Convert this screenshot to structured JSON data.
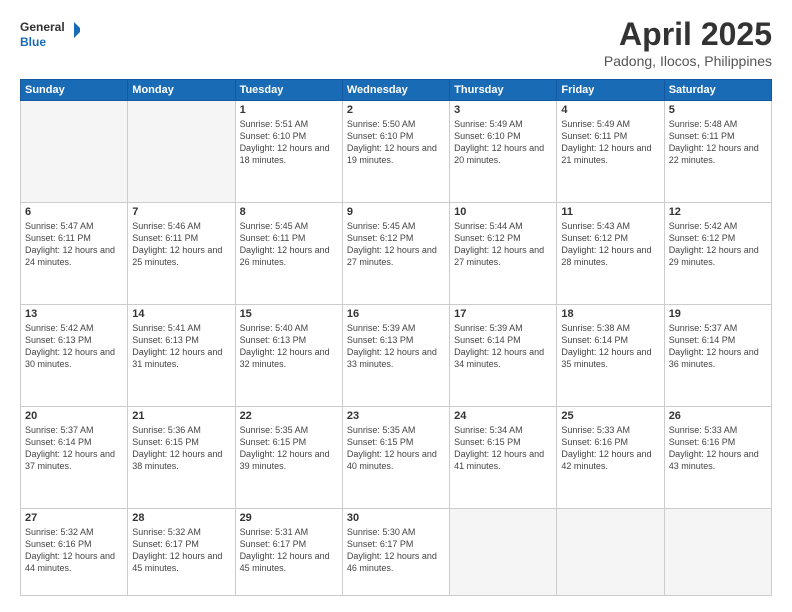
{
  "header": {
    "logo_line1": "General",
    "logo_line2": "Blue",
    "main_title": "April 2025",
    "subtitle": "Padong, Ilocos, Philippines"
  },
  "days_of_week": [
    "Sunday",
    "Monday",
    "Tuesday",
    "Wednesday",
    "Thursday",
    "Friday",
    "Saturday"
  ],
  "weeks": [
    [
      {
        "day": "",
        "info": ""
      },
      {
        "day": "",
        "info": ""
      },
      {
        "day": "1",
        "info": "Sunrise: 5:51 AM\nSunset: 6:10 PM\nDaylight: 12 hours\nand 18 minutes."
      },
      {
        "day": "2",
        "info": "Sunrise: 5:50 AM\nSunset: 6:10 PM\nDaylight: 12 hours\nand 19 minutes."
      },
      {
        "day": "3",
        "info": "Sunrise: 5:49 AM\nSunset: 6:10 PM\nDaylight: 12 hours\nand 20 minutes."
      },
      {
        "day": "4",
        "info": "Sunrise: 5:49 AM\nSunset: 6:11 PM\nDaylight: 12 hours\nand 21 minutes."
      },
      {
        "day": "5",
        "info": "Sunrise: 5:48 AM\nSunset: 6:11 PM\nDaylight: 12 hours\nand 22 minutes."
      }
    ],
    [
      {
        "day": "6",
        "info": "Sunrise: 5:47 AM\nSunset: 6:11 PM\nDaylight: 12 hours\nand 24 minutes."
      },
      {
        "day": "7",
        "info": "Sunrise: 5:46 AM\nSunset: 6:11 PM\nDaylight: 12 hours\nand 25 minutes."
      },
      {
        "day": "8",
        "info": "Sunrise: 5:45 AM\nSunset: 6:11 PM\nDaylight: 12 hours\nand 26 minutes."
      },
      {
        "day": "9",
        "info": "Sunrise: 5:45 AM\nSunset: 6:12 PM\nDaylight: 12 hours\nand 27 minutes."
      },
      {
        "day": "10",
        "info": "Sunrise: 5:44 AM\nSunset: 6:12 PM\nDaylight: 12 hours\nand 27 minutes."
      },
      {
        "day": "11",
        "info": "Sunrise: 5:43 AM\nSunset: 6:12 PM\nDaylight: 12 hours\nand 28 minutes."
      },
      {
        "day": "12",
        "info": "Sunrise: 5:42 AM\nSunset: 6:12 PM\nDaylight: 12 hours\nand 29 minutes."
      }
    ],
    [
      {
        "day": "13",
        "info": "Sunrise: 5:42 AM\nSunset: 6:13 PM\nDaylight: 12 hours\nand 30 minutes."
      },
      {
        "day": "14",
        "info": "Sunrise: 5:41 AM\nSunset: 6:13 PM\nDaylight: 12 hours\nand 31 minutes."
      },
      {
        "day": "15",
        "info": "Sunrise: 5:40 AM\nSunset: 6:13 PM\nDaylight: 12 hours\nand 32 minutes."
      },
      {
        "day": "16",
        "info": "Sunrise: 5:39 AM\nSunset: 6:13 PM\nDaylight: 12 hours\nand 33 minutes."
      },
      {
        "day": "17",
        "info": "Sunrise: 5:39 AM\nSunset: 6:14 PM\nDaylight: 12 hours\nand 34 minutes."
      },
      {
        "day": "18",
        "info": "Sunrise: 5:38 AM\nSunset: 6:14 PM\nDaylight: 12 hours\nand 35 minutes."
      },
      {
        "day": "19",
        "info": "Sunrise: 5:37 AM\nSunset: 6:14 PM\nDaylight: 12 hours\nand 36 minutes."
      }
    ],
    [
      {
        "day": "20",
        "info": "Sunrise: 5:37 AM\nSunset: 6:14 PM\nDaylight: 12 hours\nand 37 minutes."
      },
      {
        "day": "21",
        "info": "Sunrise: 5:36 AM\nSunset: 6:15 PM\nDaylight: 12 hours\nand 38 minutes."
      },
      {
        "day": "22",
        "info": "Sunrise: 5:35 AM\nSunset: 6:15 PM\nDaylight: 12 hours\nand 39 minutes."
      },
      {
        "day": "23",
        "info": "Sunrise: 5:35 AM\nSunset: 6:15 PM\nDaylight: 12 hours\nand 40 minutes."
      },
      {
        "day": "24",
        "info": "Sunrise: 5:34 AM\nSunset: 6:15 PM\nDaylight: 12 hours\nand 41 minutes."
      },
      {
        "day": "25",
        "info": "Sunrise: 5:33 AM\nSunset: 6:16 PM\nDaylight: 12 hours\nand 42 minutes."
      },
      {
        "day": "26",
        "info": "Sunrise: 5:33 AM\nSunset: 6:16 PM\nDaylight: 12 hours\nand 43 minutes."
      }
    ],
    [
      {
        "day": "27",
        "info": "Sunrise: 5:32 AM\nSunset: 6:16 PM\nDaylight: 12 hours\nand 44 minutes."
      },
      {
        "day": "28",
        "info": "Sunrise: 5:32 AM\nSunset: 6:17 PM\nDaylight: 12 hours\nand 45 minutes."
      },
      {
        "day": "29",
        "info": "Sunrise: 5:31 AM\nSunset: 6:17 PM\nDaylight: 12 hours\nand 45 minutes."
      },
      {
        "day": "30",
        "info": "Sunrise: 5:30 AM\nSunset: 6:17 PM\nDaylight: 12 hours\nand 46 minutes."
      },
      {
        "day": "",
        "info": ""
      },
      {
        "day": "",
        "info": ""
      },
      {
        "day": "",
        "info": ""
      }
    ]
  ]
}
